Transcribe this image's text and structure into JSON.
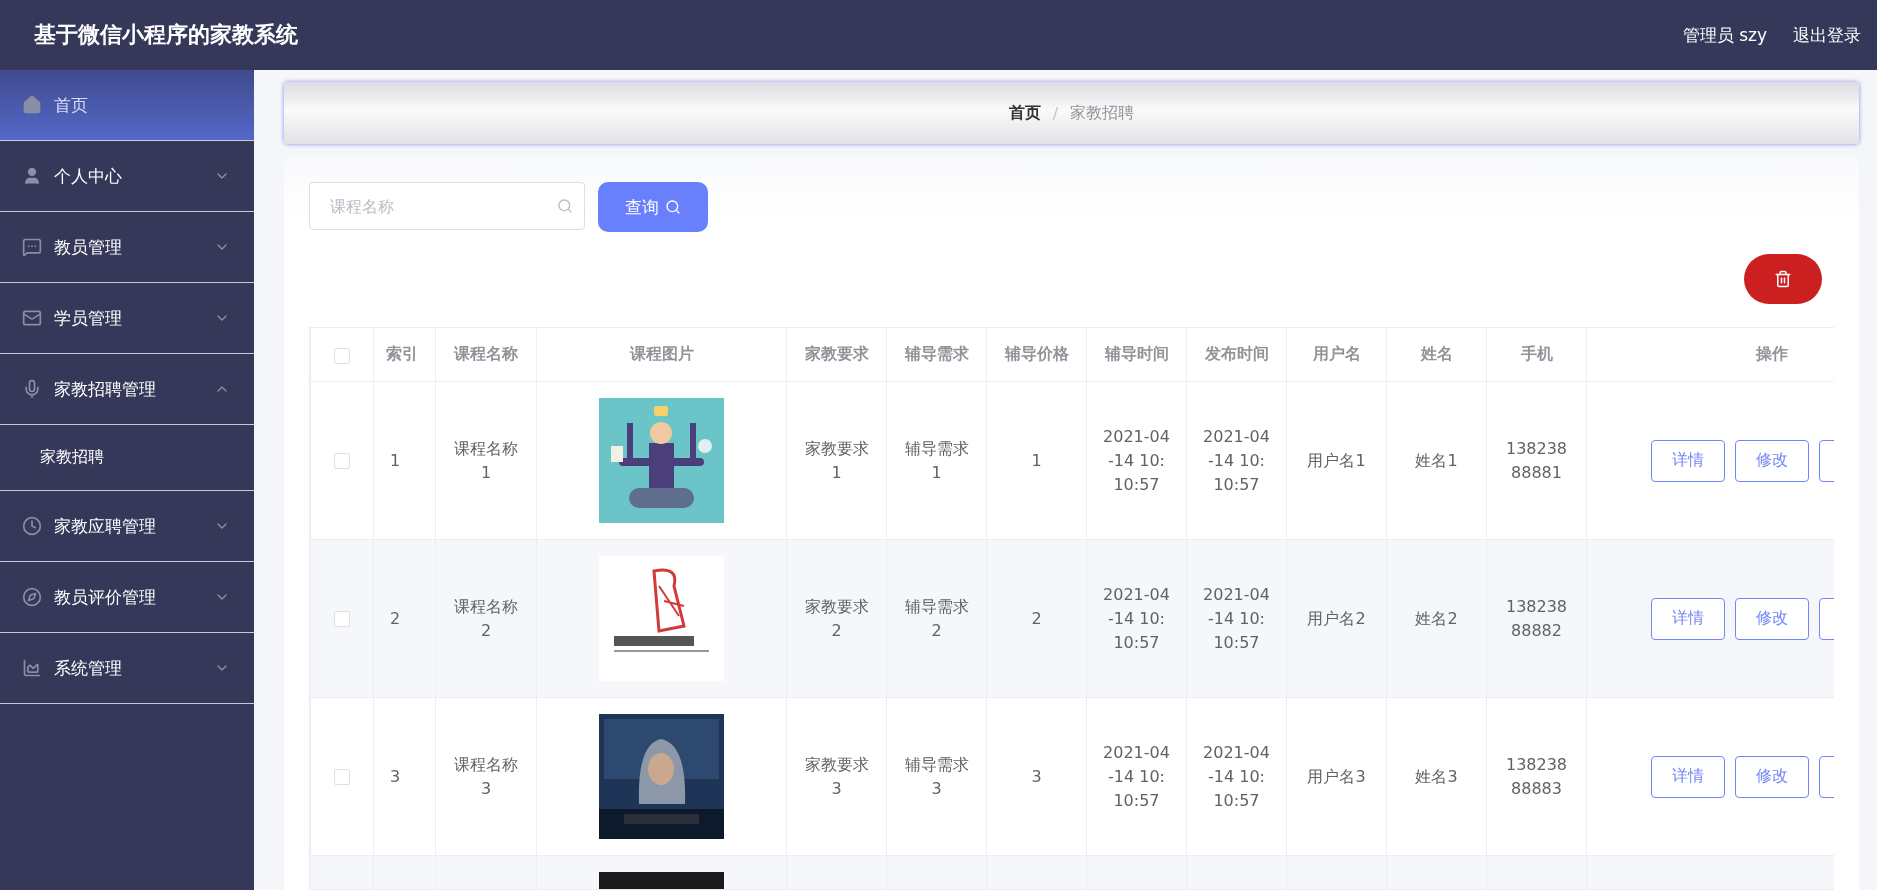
{
  "header": {
    "title": "基于微信小程序的家教系统",
    "user": "管理员 szy",
    "logout": "退出登录"
  },
  "sidebar": {
    "items": [
      {
        "label": "首页",
        "kind": "link",
        "selected": true
      },
      {
        "label": "个人中心",
        "kind": "submenu",
        "selected": false,
        "expanded": false
      },
      {
        "label": "教员管理",
        "kind": "submenu",
        "selected": false,
        "expanded": false
      },
      {
        "label": "学员管理",
        "kind": "submenu",
        "selected": false,
        "expanded": false
      },
      {
        "label": "家教招聘管理",
        "kind": "submenu",
        "selected": false,
        "expanded": true,
        "children": [
          {
            "label": "家教招聘",
            "selected": false
          }
        ]
      },
      {
        "label": "家教应聘管理",
        "kind": "submenu",
        "selected": false,
        "expanded": false
      },
      {
        "label": "教员评价管理",
        "kind": "submenu",
        "selected": false,
        "expanded": false
      },
      {
        "label": "系统管理",
        "kind": "submenu",
        "selected": false,
        "expanded": false
      }
    ]
  },
  "breadcrumb": {
    "items": [
      "首页",
      "家教招聘"
    ],
    "separator": "/"
  },
  "search": {
    "placeholder": "课程名称",
    "button": "查询"
  },
  "table": {
    "header_checkbox": {
      "checked": false
    },
    "columns": [
      "索引",
      "课程名称",
      "课程图片",
      "家教要求",
      "辅导需求",
      "辅导价格",
      "辅导时间",
      "发布时间",
      "用户名",
      "姓名",
      "手机",
      "操作"
    ],
    "rows": [
      {
        "checked": false,
        "index": "1",
        "course": "课程名称1",
        "picture": {
          "kind": "picture"
        },
        "requirement": "家教要求1",
        "need": "辅导需求1",
        "price": "1",
        "tutor_time": "2021-04-14 10:10:57",
        "publish_time": "2021-04-14 10:10:57",
        "username": "用户名1",
        "name": "姓名1",
        "phone": "13823888881",
        "actions": [
          "详情",
          "修改"
        ]
      },
      {
        "checked": false,
        "index": "2",
        "course": "课程名称2",
        "picture": {
          "kind": "picture"
        },
        "requirement": "家教要求2",
        "need": "辅导需求2",
        "price": "2",
        "tutor_time": "2021-04-14 10:10:57",
        "publish_time": "2021-04-14 10:10:57",
        "username": "用户名2",
        "name": "姓名2",
        "phone": "13823888882",
        "actions": [
          "详情",
          "修改"
        ]
      },
      {
        "checked": false,
        "index": "3",
        "course": "课程名称3",
        "picture": {
          "kind": "picture"
        },
        "requirement": "家教要求3",
        "need": "辅导需求3",
        "price": "3",
        "tutor_time": "2021-04-14 10:10:57",
        "publish_time": "2021-04-14 10:10:57",
        "username": "用户名3",
        "name": "姓名3",
        "phone": "13823888883",
        "actions": [
          "详情",
          "修改"
        ]
      },
      {
        "picture": {
          "kind": "picture"
        }
      }
    ]
  }
}
